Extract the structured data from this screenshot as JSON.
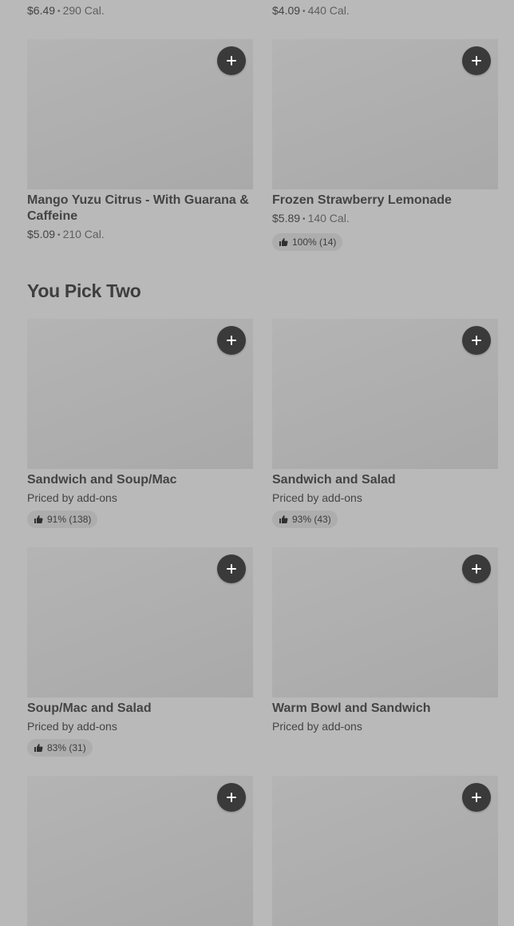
{
  "top_partial": {
    "left": {
      "price": "$6.49",
      "cal": "290 Cal."
    },
    "right": {
      "price": "$4.09",
      "cal": "440 Cal."
    }
  },
  "drinks": [
    {
      "name": "Mango Yuzu Citrus - With Guarana & Caffeine",
      "price": "$5.09",
      "cal": "210 Cal."
    },
    {
      "name": "Frozen Strawberry Lemonade",
      "price": "$5.89",
      "cal": "140 Cal.",
      "rating": "100% (14)"
    }
  ],
  "section": {
    "title": "You Pick Two"
  },
  "pick_two": [
    {
      "name": "Sandwich and Soup/Mac",
      "price_text": "Priced by add-ons",
      "rating": "91% (138)"
    },
    {
      "name": "Sandwich and Salad",
      "price_text": "Priced by add-ons",
      "rating": "93% (43)"
    },
    {
      "name": "Soup/Mac and Salad",
      "price_text": "Priced by add-ons",
      "rating": "83% (31)"
    },
    {
      "name": "Warm Bowl and Sandwich",
      "price_text": "Priced by add-ons"
    }
  ],
  "icons": {
    "add": "plus-icon",
    "rating": "thumbs-up-icon"
  },
  "colors": {
    "background": "#b9b9b9",
    "image_placeholder": "#aeaeae",
    "add_button": "#3a3a3a",
    "rating_pill": "#adadad"
  }
}
